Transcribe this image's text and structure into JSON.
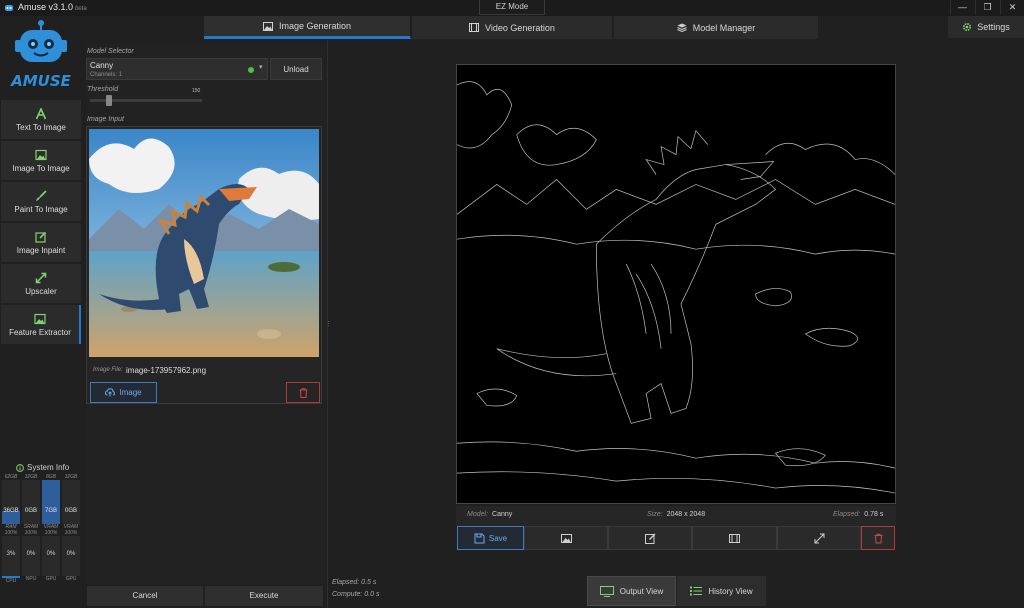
{
  "app": {
    "title": "Amuse v3.1.0",
    "beta": "beta",
    "mode_button": "EZ Mode",
    "logo_text": "AMUSE"
  },
  "window": {
    "minimize": "—",
    "restore": "❐",
    "close": "✕"
  },
  "top_tabs": [
    {
      "label": "Image Generation",
      "icon": "image-icon",
      "active": true
    },
    {
      "label": "Video Generation",
      "icon": "film-icon",
      "active": false
    },
    {
      "label": "Model Manager",
      "icon": "layers-icon",
      "active": false
    }
  ],
  "settings": {
    "label": "Settings",
    "icon": "gear-icon"
  },
  "sidebar": {
    "items": [
      {
        "label": "Text To Image",
        "icon": "text-icon"
      },
      {
        "label": "Image To Image",
        "icon": "image-icon"
      },
      {
        "label": "Paint To Image",
        "icon": "brush-icon"
      },
      {
        "label": "Image Inpaint",
        "icon": "edit-icon"
      },
      {
        "label": "Upscaler",
        "icon": "expand-icon"
      },
      {
        "label": "Feature Extractor",
        "icon": "image-icon",
        "active": true
      }
    ]
  },
  "system_info": {
    "title": "System Info",
    "columns": [
      {
        "total": "62GB",
        "used": "36GB",
        "fill": 0.3,
        "highlight": true,
        "pct_cap": "",
        "pct": "3%",
        "label": "CPU",
        "active": true
      },
      {
        "total": "32GB",
        "used": "0GB",
        "fill": 0.0,
        "highlight": false,
        "pct_cap": "",
        "pct": "0%",
        "label": "NPU",
        "active": false
      },
      {
        "total": "8GB",
        "used": "7GB",
        "fill": 1.0,
        "highlight": true,
        "pct_cap": "100%",
        "pct": "0%",
        "label": "GPU",
        "active": false
      },
      {
        "total": "32GB",
        "used": "0GB",
        "fill": 0.0,
        "highlight": false,
        "pct_cap": "100%",
        "pct": "0%",
        "label": "GPU",
        "active": false
      }
    ],
    "mem_labels": [
      "RAM",
      "SRAM",
      "VRAM",
      "VRAM"
    ],
    "pct_caps": [
      "100%",
      "100%",
      "100%",
      "100%"
    ]
  },
  "model_selector": {
    "label": "Model Selector",
    "model": "Canny",
    "channels": "Channels: 1",
    "status_color": "#4cc24c",
    "unload": "Unload"
  },
  "threshold": {
    "label": "Threshold",
    "value": "150",
    "fraction": 0.15
  },
  "image_input": {
    "label": "Image Input",
    "file_label": "Image File:",
    "file_name": "image-173957962.png",
    "button": "Image"
  },
  "actions": {
    "cancel": "Cancel",
    "execute": "Execute"
  },
  "output": {
    "model_label": "Model:",
    "model_value": "Canny",
    "size_label": "Size:",
    "size_value": "2048 x 2048",
    "elapsed_label": "Elapsed:",
    "elapsed_value": "0.78 s",
    "save": "Save"
  },
  "footer": {
    "elapsed": "Elapsed: 0.5 s",
    "compute": "Compute: 0.0 s",
    "output_view": "Output View",
    "history_view": "History View"
  },
  "colors": {
    "accent": "#1f7bd0",
    "danger": "#b03a3a",
    "status_ok": "#4cc24c"
  }
}
